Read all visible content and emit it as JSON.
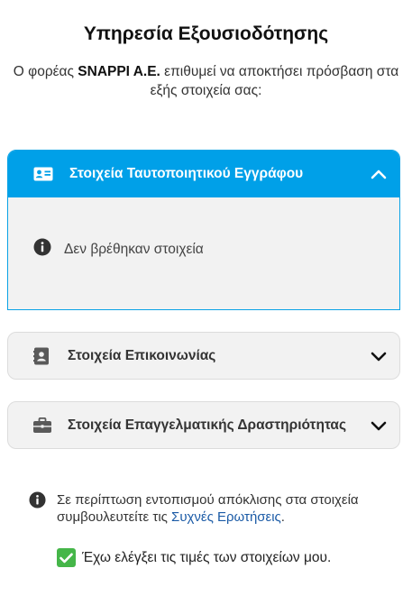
{
  "page": {
    "title": "Υπηρεσία Εξουσιοδότησης",
    "intro_prefix": "Ο φορέας ",
    "intro_org": "SNAPPI A.E.",
    "intro_suffix": " επιθυμεί να αποκτήσει πρόσβαση στα εξής στοιχεία σας:"
  },
  "sections": [
    {
      "label": "Στοιχεία Ταυτοποιητικού Εγγράφου",
      "icon": "id-card-icon",
      "expanded": true,
      "empty_message": "Δεν βρέθηκαν στοιχεία"
    },
    {
      "label": "Στοιχεία Επικοινωνίας",
      "icon": "contact-book-icon",
      "expanded": false
    },
    {
      "label": "Στοιχεία Επαγγελματικής Δραστηριότητας",
      "icon": "briefcase-icon",
      "expanded": false
    }
  ],
  "note": {
    "text": "Σε περίπτωση εντοπισμού απόκλισης στα στοιχεία συμβουλευτείτε τις ",
    "link": "Συχνές Ερωτήσεις",
    "suffix": "."
  },
  "confirm": {
    "label": "Έχω ελέγξει τις τιμές των στοιχείων μου.",
    "checked": true
  },
  "colors": {
    "accent": "#00a0e8",
    "check": "#45b649",
    "link": "#1a5aa6"
  }
}
